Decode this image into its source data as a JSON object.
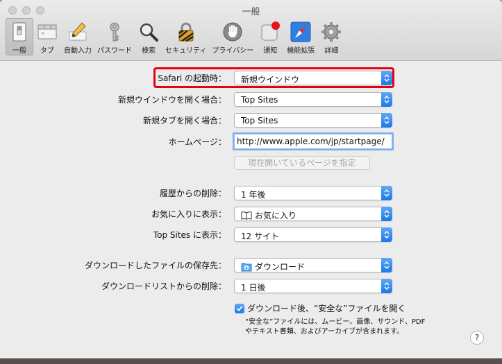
{
  "window": {
    "title": "一般"
  },
  "toolbar": {
    "items": [
      {
        "label": "一般",
        "icon": "switch-icon"
      },
      {
        "label": "タブ",
        "icon": "tabs-icon"
      },
      {
        "label": "自動入力",
        "icon": "pencil-icon"
      },
      {
        "label": "パスワード",
        "icon": "key-icon"
      },
      {
        "label": "検索",
        "icon": "magnifier-icon"
      },
      {
        "label": "セキュリティ",
        "icon": "lock-icon"
      },
      {
        "label": "プライバシー",
        "icon": "hand-icon"
      },
      {
        "label": "通知",
        "icon": "notification-icon"
      },
      {
        "label": "機能拡張",
        "icon": "extensions-icon"
      },
      {
        "label": "詳細",
        "icon": "gear-icon"
      }
    ]
  },
  "settings": {
    "startup": {
      "label": "Safari の起動時：",
      "value": "新規ウインドウ"
    },
    "new_window": {
      "label": "新規ウインドウを開く場合：",
      "value": "Top Sites"
    },
    "new_tab": {
      "label": "新規タブを開く場合：",
      "value": "Top Sites"
    },
    "homepage": {
      "label": "ホームページ：",
      "value": "http://www.apple.com/jp/startpage/"
    },
    "set_current": {
      "label": "現在開いているページを指定"
    },
    "history_remove": {
      "label": "履歴からの削除：",
      "value": "1 年後"
    },
    "favorites_show": {
      "label": "お気に入りに表示：",
      "value": "お気に入り"
    },
    "topsites_show": {
      "label": "Top Sites に表示：",
      "value": "12 サイト"
    },
    "download_location": {
      "label": "ダウンロードしたファイルの保存先：",
      "value": "ダウンロード"
    },
    "download_list_remove": {
      "label": "ダウンロードリストからの削除：",
      "value": "1 日後"
    },
    "open_safe": {
      "label": "ダウンロード後、“安全な”ファイルを開く",
      "checked": true
    },
    "safe_note": "“安全な”ファイルには、ムービー、画像、サウンド、PDF やテキスト書類、およびアーカイブが含まれます。"
  },
  "help": {
    "label": "?"
  },
  "colors": {
    "accent": "#1c78e8",
    "highlight": "#e60012"
  }
}
